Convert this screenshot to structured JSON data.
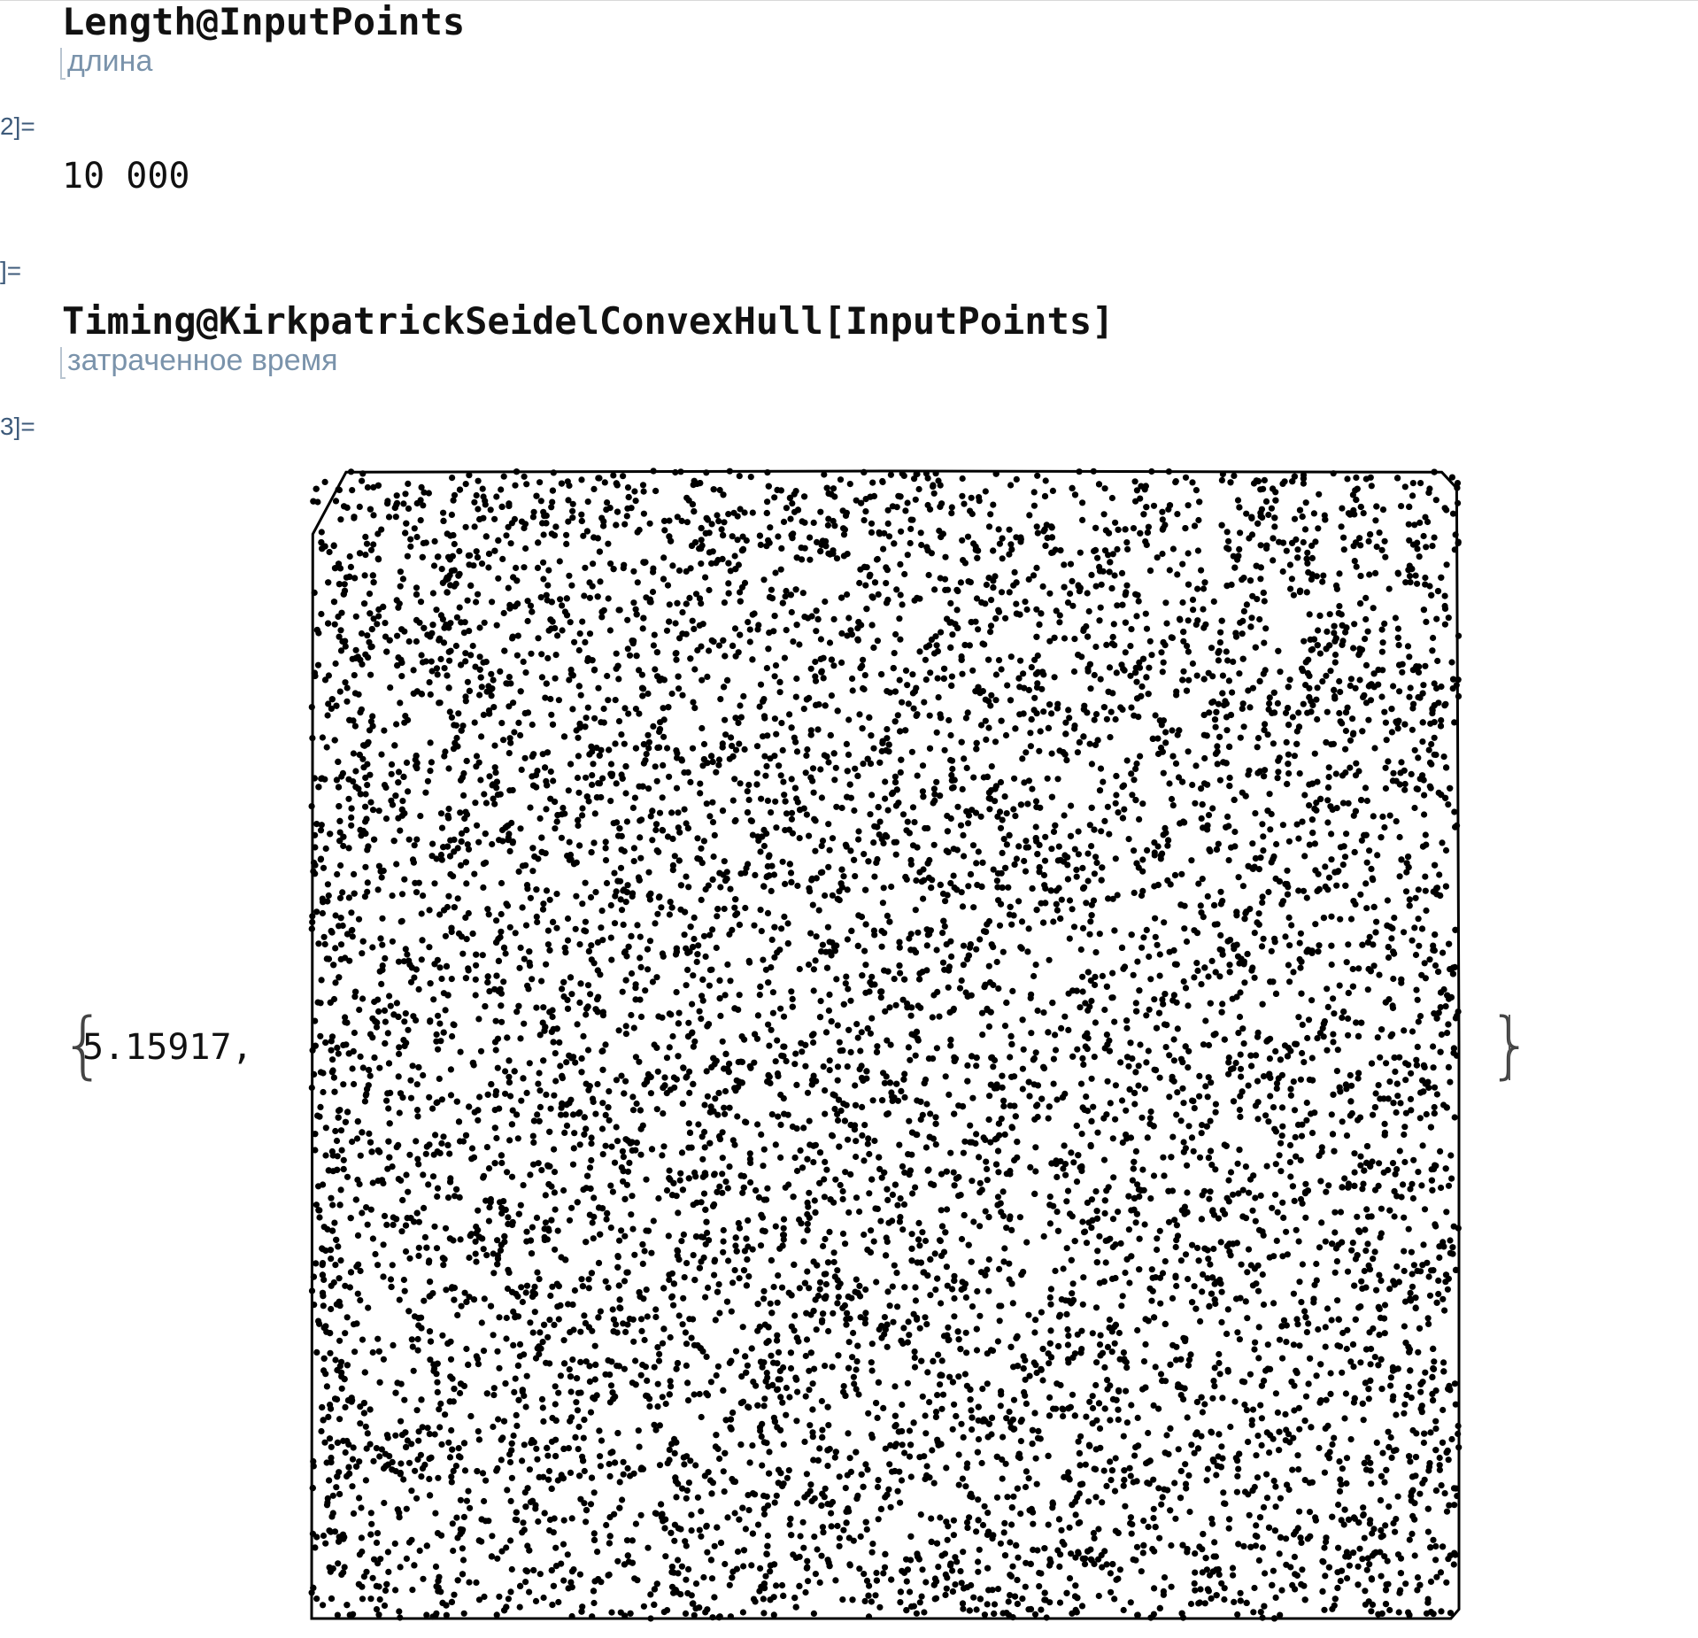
{
  "cells": {
    "in1": {
      "code": "Length@InputPoints",
      "hint": "длина"
    },
    "out2": {
      "label": "2]=",
      "value": "10 000"
    },
    "in3": {
      "label": "]=",
      "code": "Timing@KirkpatrickSeidelConvexHull[InputPoints]",
      "hint": "затраченное время"
    },
    "out3": {
      "label": "3]=",
      "timing": "5.15917,"
    }
  },
  "chart_data": {
    "type": "scatter",
    "point_count": 10000,
    "distribution": "uniform random",
    "xlim": [
      0,
      1
    ],
    "ylim": [
      0,
      1
    ],
    "axes": false,
    "frame": false,
    "hull": {
      "type": "convex hull polygon",
      "vertices": [
        [
          0.0,
          0.0
        ],
        [
          0.001,
          0.945
        ],
        [
          0.03,
          0.999
        ],
        [
          0.5,
          1.0
        ],
        [
          0.985,
          0.999
        ],
        [
          0.998,
          0.985
        ],
        [
          1.0,
          0.5
        ],
        [
          1.0,
          0.008
        ],
        [
          0.993,
          0.0
        ],
        [
          0.5,
          0.0
        ]
      ]
    },
    "point_color": "#000000",
    "hull_color": "#000000"
  }
}
